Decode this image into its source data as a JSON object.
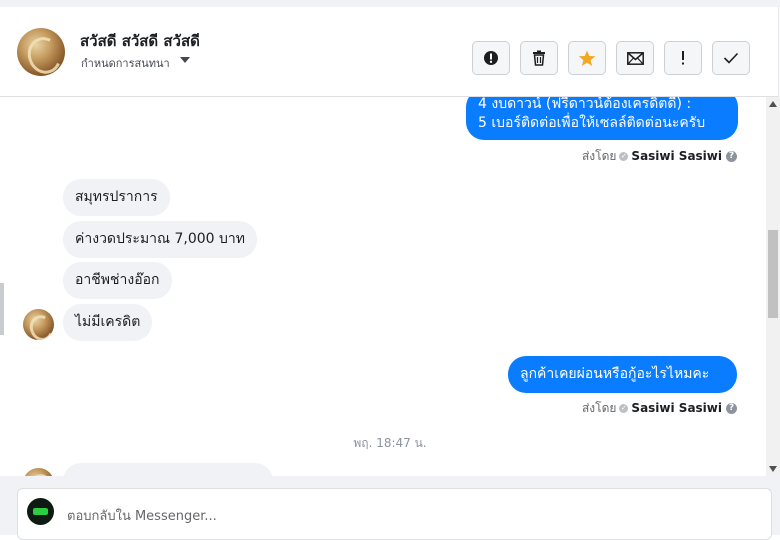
{
  "header": {
    "contact_name": "สวัสดี สวัสดี สวัสดี",
    "subtitle": "กำหนดการสนทนา",
    "actions": [
      {
        "name": "report-button",
        "icon": "exclamation-circle-icon",
        "glyph": "⬤"
      },
      {
        "name": "delete-button",
        "icon": "trash-icon",
        "glyph": "🗑"
      },
      {
        "name": "star-button",
        "icon": "star-icon",
        "glyph": "★"
      },
      {
        "name": "mark-unread-button",
        "icon": "envelope-icon",
        "glyph": "✉"
      },
      {
        "name": "important-button",
        "icon": "exclamation-icon",
        "glyph": "!"
      },
      {
        "name": "done-button",
        "icon": "check-icon",
        "glyph": "✓"
      }
    ]
  },
  "messages": {
    "top_outgoing": {
      "line1": "4 งบดาวน์ (ฟรีดาวน์ต้องเครดิตดี) :",
      "line2": "5 เบอร์ติดต่อเพื่อให้เซลล์ติดต่อนะครับ"
    },
    "sent_by_label": "ส่งโดย",
    "sent_by_name": "Sasiwi Sasiwi",
    "incoming": [
      "สมุทรปราการ",
      "ค่างวดประมาณ 7,000 บาท",
      "อาชีพช่างอ๊อก",
      "ไม่มีเครดิต"
    ],
    "outgoing_question": "ลูกค้าเคยผ่อนหรือกู้อะไรไหมคะ",
    "timestamp": "พฤ. 18:47 น."
  },
  "reply": {
    "placeholder": "ตอบกลับใน Messenger..."
  },
  "colors": {
    "accent": "#0a7cff",
    "star": "#f5a623",
    "incoming_bubble": "#f0f2f5"
  }
}
